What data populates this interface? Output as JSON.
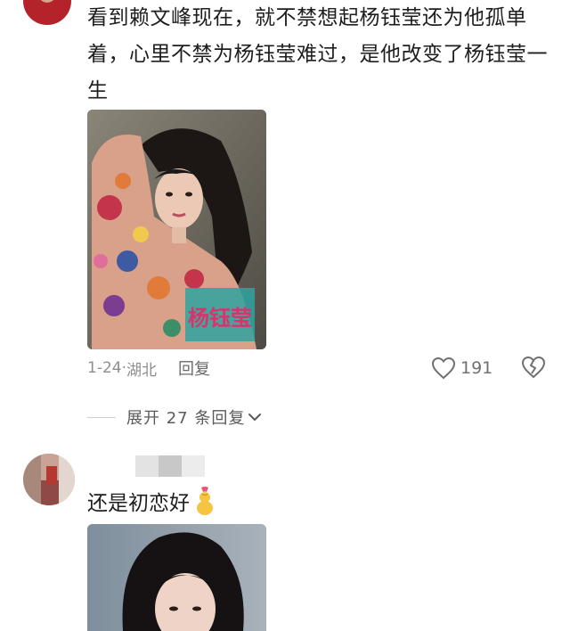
{
  "comments": [
    {
      "text": "看到赖文峰现在，就不禁想起杨钰莹还为他孤单着，心里不禁为杨钰莹难过，是他改变了杨钰莹一生",
      "photo_caption": "杨钰莹",
      "date": "1-24",
      "separator": "·",
      "location": "湖北",
      "reply_label": "回复",
      "like_count": "191",
      "expand_label": "展开 27 条回复"
    },
    {
      "text": "还是初恋好"
    }
  ],
  "icons": {
    "like": "heart-outline-icon",
    "dislike": "broken-heart-icon",
    "expand": "chevron-down-icon",
    "emoji": "gourd-emoji-icon"
  },
  "colors": {
    "text": "#1e1e1e",
    "meta": "#8e8e8e",
    "divider": "#cfcfcf"
  }
}
